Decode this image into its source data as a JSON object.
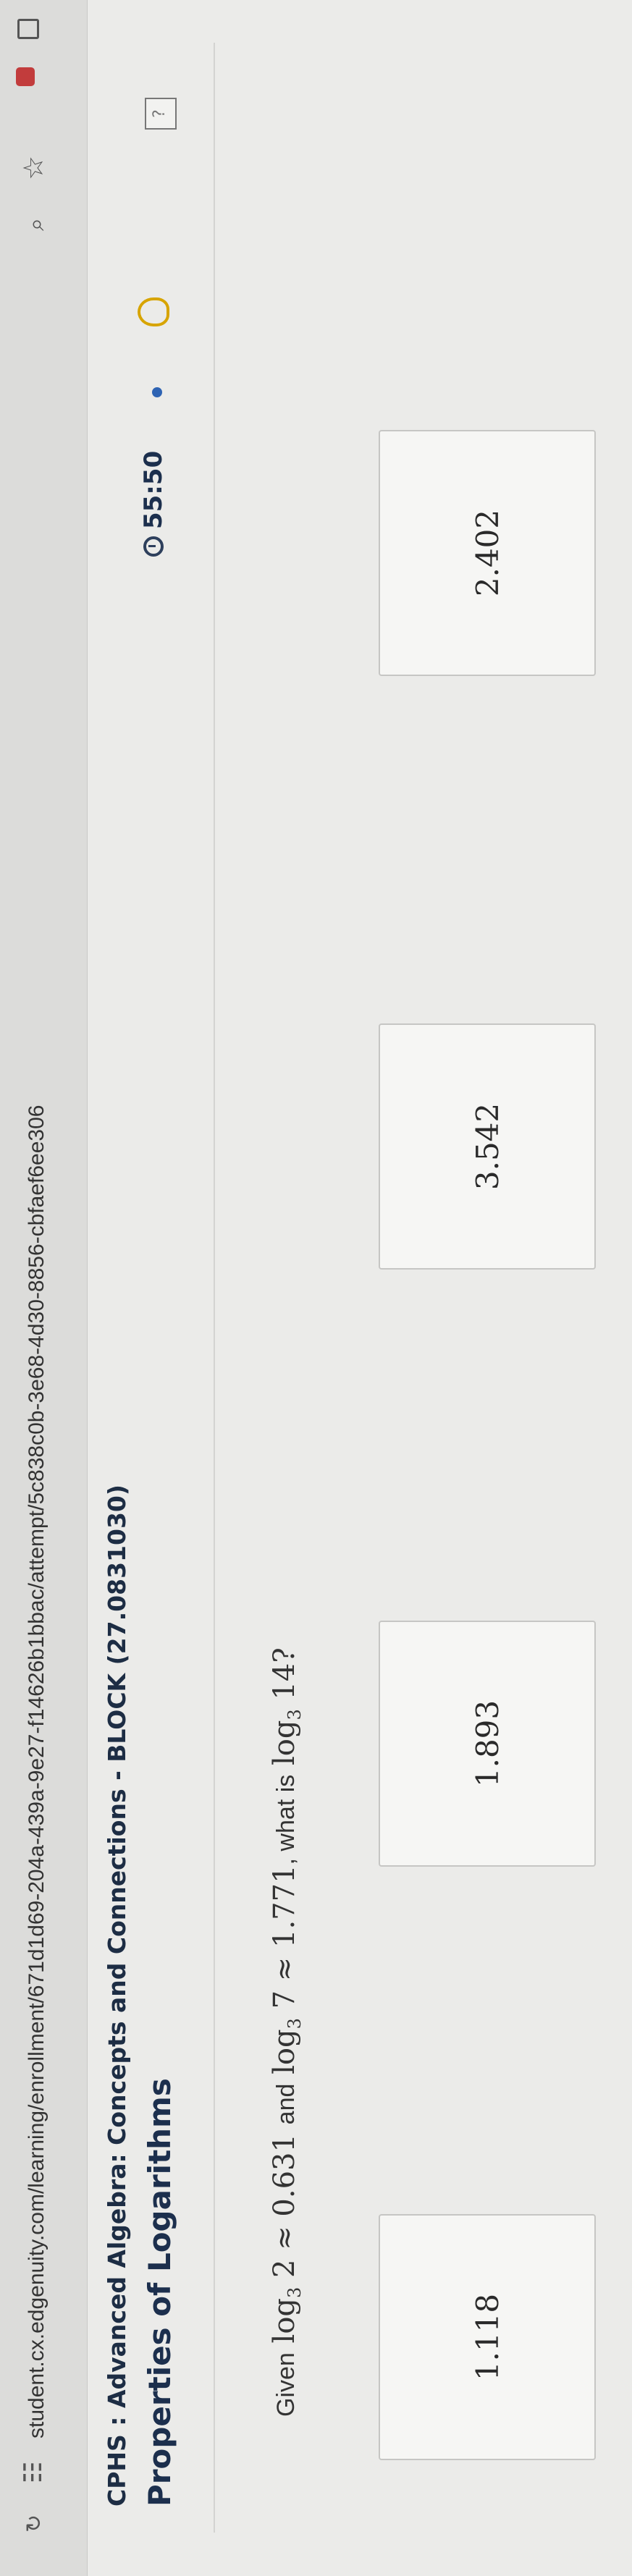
{
  "browser": {
    "url": "student.cx.edgenuity.com/learning/enrollment/671d1d69-204a-439a-9e27-f14626b1bbac/attempt/5c838c0b-3e68-4d30-8856-cbfaef6ee306"
  },
  "header": {
    "course": "CPHS : Advanced Algebra: Concepts and Connections - BLOCK (27.0831030)",
    "title": "Properties of Logarithms",
    "timer": "55:50"
  },
  "question": {
    "given_label": "Given",
    "log": "log",
    "base": "3",
    "arg1": "2",
    "approx": "≈",
    "val1": "0.631",
    "and_label": "and",
    "arg2": "7",
    "val2": "1.771",
    "what_label": ", what is",
    "arg3": "14?"
  },
  "options": [
    "1.118",
    "1.893",
    "3.542",
    "2.402"
  ],
  "colors": {
    "accent": "#1c2f4d",
    "timer_dot": "#2e63b3",
    "hint": "#d7a400"
  }
}
